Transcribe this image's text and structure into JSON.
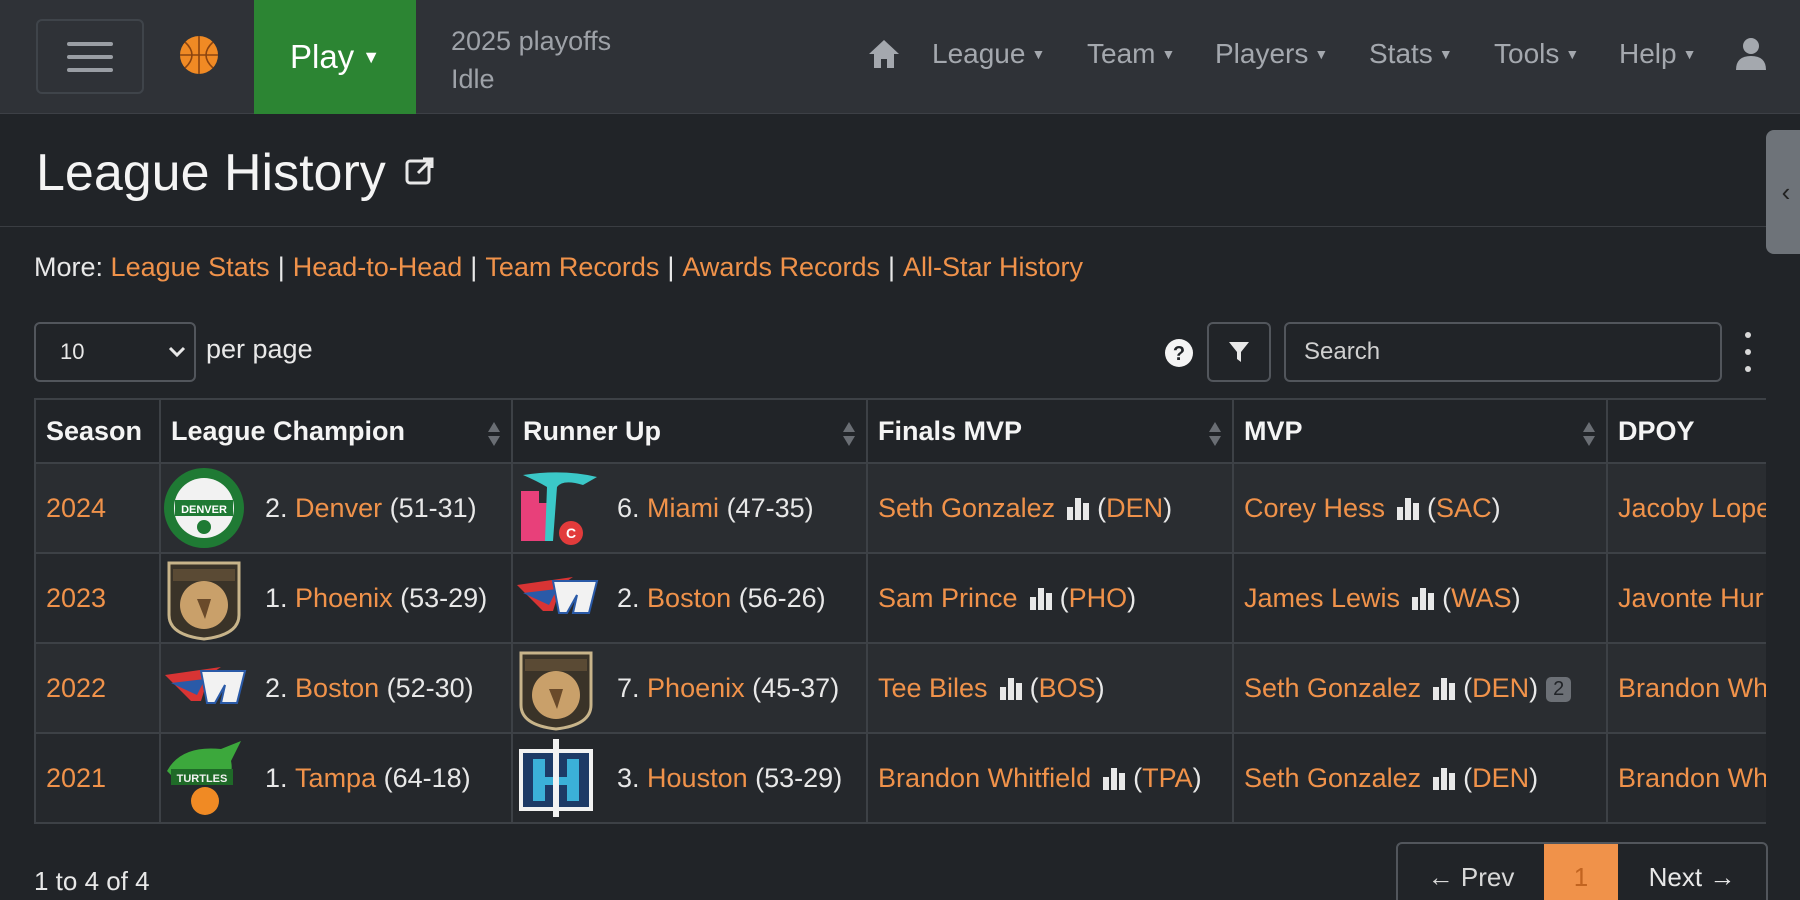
{
  "navbar": {
    "play_label": "Play",
    "phase_line1": "2025 playoffs",
    "phase_line2": "Idle",
    "menus": [
      "League",
      "Team",
      "Players",
      "Stats",
      "Tools",
      "Help"
    ]
  },
  "header": {
    "title": "League History"
  },
  "more": {
    "label": "More:",
    "links": [
      "League Stats",
      "Head-to-Head",
      "Team Records",
      "Awards Records",
      "All-Star History"
    ]
  },
  "controls": {
    "per_page_value": "10",
    "per_page_label": "per page",
    "search_placeholder": "Search"
  },
  "table": {
    "columns": [
      "Season",
      "League Champion",
      "Runner Up",
      "Finals MVP",
      "MVP",
      "DPOY"
    ],
    "rows": [
      {
        "season": "2024",
        "champ_seed": "2.",
        "champ_team": "Denver",
        "champ_record": "(51-31)",
        "runner_seed": "6.",
        "runner_team": "Miami",
        "runner_record": "(47-35)",
        "fmvp_name": "Seth Gonzalez",
        "fmvp_team": "DEN",
        "mvp_name": "Corey Hess",
        "mvp_team": "SAC",
        "mvp_badge": "",
        "dpoy": "Jacoby Lope"
      },
      {
        "season": "2023",
        "champ_seed": "1.",
        "champ_team": "Phoenix",
        "champ_record": "(53-29)",
        "runner_seed": "2.",
        "runner_team": "Boston",
        "runner_record": "(56-26)",
        "fmvp_name": "Sam Prince",
        "fmvp_team": "PHO",
        "mvp_name": "James Lewis",
        "mvp_team": "WAS",
        "mvp_badge": "",
        "dpoy": "Javonte Hur"
      },
      {
        "season": "2022",
        "champ_seed": "2.",
        "champ_team": "Boston",
        "champ_record": "(52-30)",
        "runner_seed": "7.",
        "runner_team": "Phoenix",
        "runner_record": "(45-37)",
        "fmvp_name": "Tee Biles",
        "fmvp_team": "BOS",
        "mvp_name": "Seth Gonzalez",
        "mvp_team": "DEN",
        "mvp_badge": "2",
        "dpoy": "Brandon Wh"
      },
      {
        "season": "2021",
        "champ_seed": "1.",
        "champ_team": "Tampa",
        "champ_record": "(64-18)",
        "runner_seed": "3.",
        "runner_team": "Houston",
        "runner_record": "(53-29)",
        "fmvp_name": "Brandon Whitfield",
        "fmvp_team": "TPA",
        "mvp_name": "Seth Gonzalez",
        "mvp_team": "DEN",
        "mvp_badge": "",
        "dpoy": "Brandon Wh"
      }
    ]
  },
  "footer": {
    "summary": "1 to 4 of 4",
    "prev_label": "← Prev",
    "current_page": "1",
    "next_label": "Next →"
  },
  "colors": {
    "accent_link": "#f0924a",
    "play_green": "#2c8533",
    "background": "#212428",
    "navbar": "#2f3237"
  }
}
